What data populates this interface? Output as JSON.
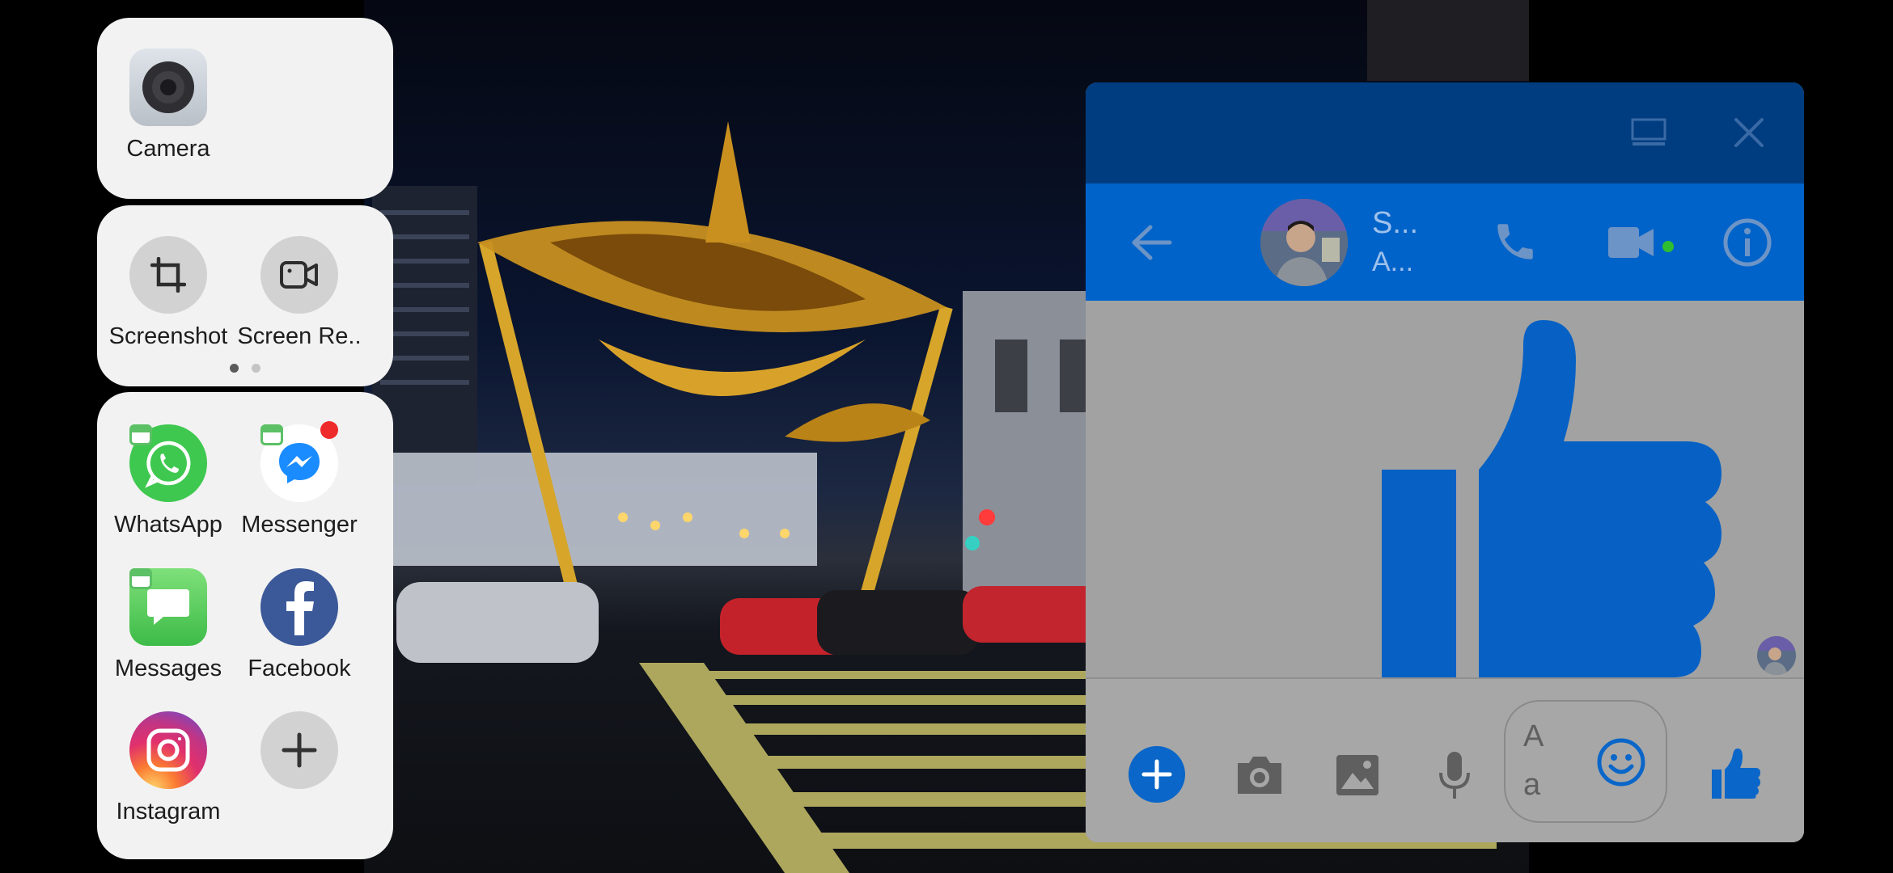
{
  "edge_panels": {
    "camera_panel": {
      "apps": [
        {
          "label": "Camera",
          "icon": "camera-icon"
        }
      ]
    },
    "tools_panel": {
      "tools": [
        {
          "label": "Screenshot",
          "icon": "crop-icon"
        },
        {
          "label": "Screen Re..",
          "icon": "video-camera-icon"
        }
      ],
      "page_dots": 2,
      "active_page": 1
    },
    "apps_panel": {
      "apps": [
        {
          "label": "WhatsApp",
          "icon": "whatsapp-icon"
        },
        {
          "label": "Messenger",
          "icon": "messenger-icon",
          "has_notification": true
        },
        {
          "label": "Messages",
          "icon": "messages-icon"
        },
        {
          "label": "Facebook",
          "icon": "facebook-icon"
        },
        {
          "label": "Instagram",
          "icon": "instagram-icon"
        },
        {
          "label": "",
          "icon": "add-icon"
        }
      ]
    }
  },
  "messenger_window": {
    "contact_name": "S...",
    "contact_status": "A...",
    "text_input_placeholder_line1": "A",
    "text_input_placeholder_line2": "a",
    "colors": {
      "titlebar": "#003d80",
      "header": "#0063c9",
      "accent": "#0a66c8",
      "online_dot": "#2fbe2f"
    }
  }
}
